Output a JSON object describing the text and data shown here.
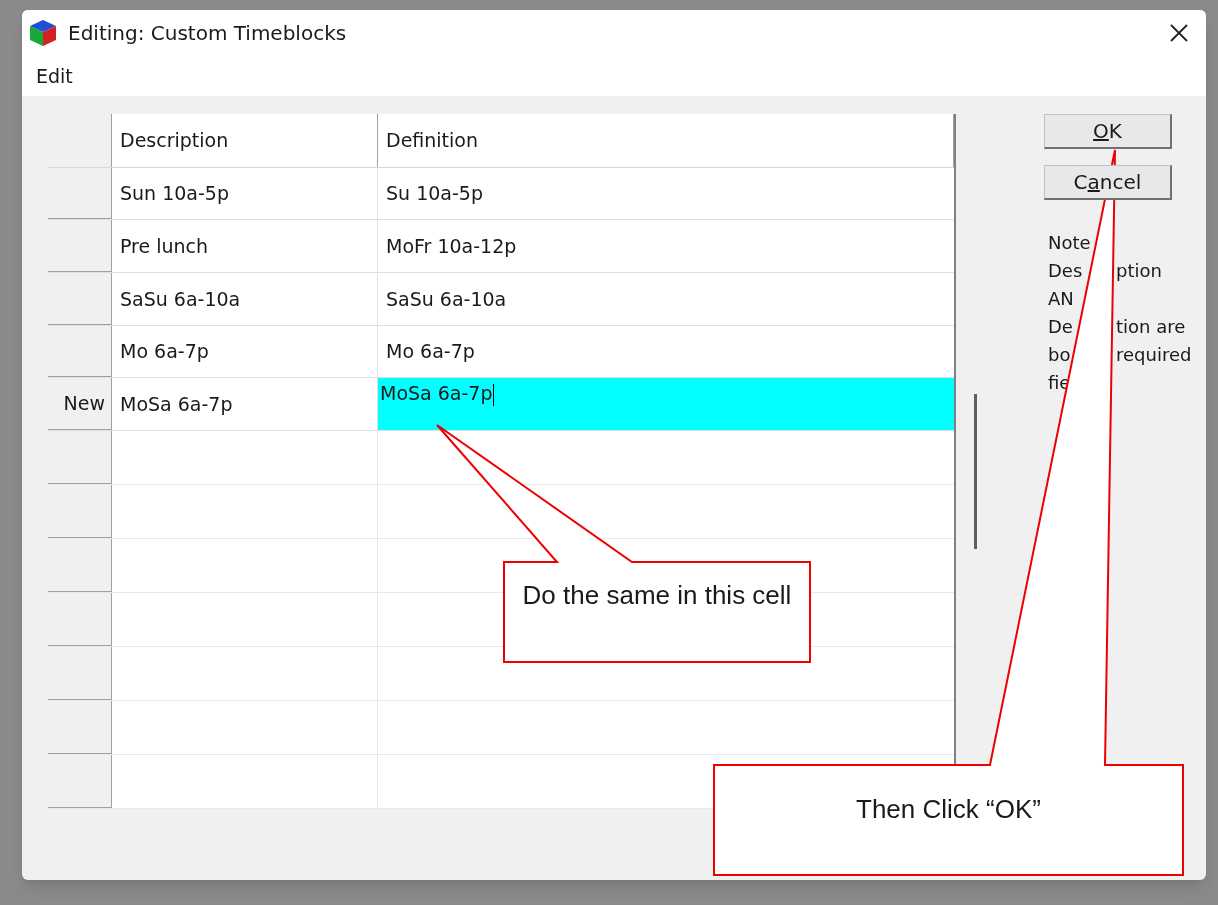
{
  "window": {
    "title": "Editing: Custom Timeblocks"
  },
  "menu": [
    "Edit"
  ],
  "table": {
    "columns": [
      "Description",
      "Definition"
    ],
    "rows": [
      {
        "header": "",
        "description": "Sun 10a-5p",
        "definition": "Su 10a-5p",
        "editing": false
      },
      {
        "header": "",
        "description": "Pre lunch",
        "definition": "MoFr 10a-12p",
        "editing": false
      },
      {
        "header": "",
        "description": "SaSu 6a-10a",
        "definition": "SaSu 6a-10a",
        "editing": false
      },
      {
        "header": "",
        "description": "Mo 6a-7p",
        "definition": "Mo 6a-7p",
        "editing": false
      },
      {
        "header": "New",
        "description": "MoSa 6a-7p",
        "definition": "MoSa 6a-7p",
        "editing": true
      }
    ]
  },
  "buttons": [
    {
      "label": "OK",
      "kind": "ok"
    },
    {
      "label": "Cancel",
      "kind": "cancel"
    }
  ],
  "note": {
    "lines": [
      [
        "Note"
      ],
      [
        "Des",
        "ption"
      ],
      [
        "AN"
      ],
      [
        "De",
        "tion are"
      ],
      [
        "bo",
        "required"
      ],
      [
        "fie"
      ]
    ]
  },
  "callouts": [
    {
      "text": "Do the same in this cell"
    },
    {
      "text": "Then Click “OK”"
    }
  ]
}
